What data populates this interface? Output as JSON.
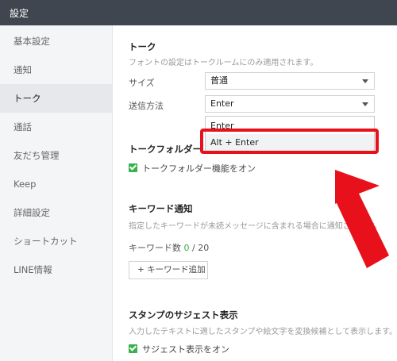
{
  "window": {
    "title": "設定"
  },
  "sidebar": {
    "items": [
      {
        "label": "基本設定"
      },
      {
        "label": "通知"
      },
      {
        "label": "トーク"
      },
      {
        "label": "通話"
      },
      {
        "label": "友だち管理"
      },
      {
        "label": "Keep"
      },
      {
        "label": "詳細設定"
      },
      {
        "label": "ショートカット"
      },
      {
        "label": "LINE情報"
      }
    ],
    "active_index": 2
  },
  "talk": {
    "title": "トーク",
    "description": "フォントの設定はトークルームにのみ適用されます。",
    "size_label": "サイズ",
    "size_value": "普通",
    "send_method_label": "送信方法",
    "send_method_value": "Enter",
    "send_method_options": [
      "Enter",
      "Alt + Enter"
    ],
    "highlighted_option": "Alt + Enter"
  },
  "talk_folder": {
    "title": "トークフォルダー",
    "checkbox_label": "トークフォルダー機能をオン",
    "checked": true
  },
  "keyword": {
    "title": "キーワード通知",
    "description": "指定したキーワードが未読メッセージに含まれる場合に通知されます。",
    "count_label": "キーワード数",
    "count_value": "0",
    "count_max": "/ 20",
    "add_button": "+ キーワード追加"
  },
  "sticker": {
    "title": "スタンプのサジェスト表示",
    "description": "入力したテキストに適したスタンプや絵文字を変換候補として表示します。",
    "checkbox_label": "サジェスト表示をオン",
    "checked": true
  },
  "colors": {
    "annotation_red": "#e8101a",
    "check_green": "#37b24d",
    "titlebar": "#3f4650"
  }
}
